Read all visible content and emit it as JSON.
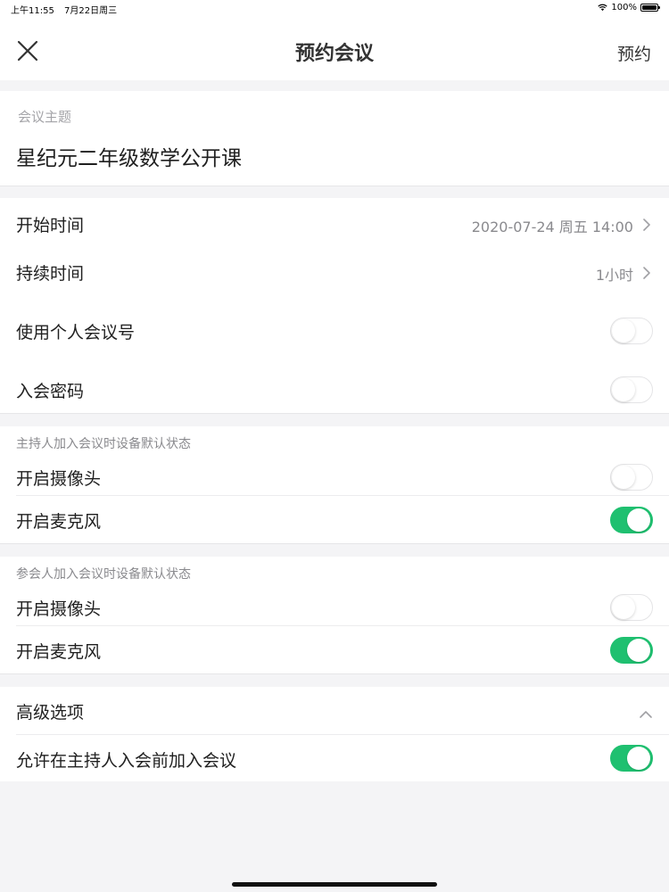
{
  "status_bar": {
    "time": "上午11:55",
    "date": "7月22日周三",
    "battery": "100%"
  },
  "nav": {
    "title": "预约会议",
    "action_label": "预约"
  },
  "topic": {
    "label": "会议主题",
    "value": "星纪元二年级数学公开课"
  },
  "settings": {
    "start_time_label": "开始时间",
    "start_time_value": "2020-07-24 周五 14:00",
    "duration_label": "持续时间",
    "duration_value": "1小时",
    "personal_id_label": "使用个人会议号",
    "personal_id_on": false,
    "password_label": "入会密码",
    "password_on": false
  },
  "host_defaults": {
    "caption": "主持人加入会议时设备默认状态",
    "camera_label": "开启摄像头",
    "camera_on": false,
    "mic_label": "开启麦克风",
    "mic_on": true
  },
  "participant_defaults": {
    "caption": "参会人加入会议时设备默认状态",
    "camera_label": "开启摄像头",
    "camera_on": false,
    "mic_label": "开启麦克风",
    "mic_on": true
  },
  "advanced": {
    "label": "高级选项",
    "expanded": true,
    "join_before_host_label": "允许在主持人入会前加入会议",
    "join_before_host_on": true
  },
  "colors": {
    "toggle_on": "#1fc070",
    "background": "#f4f4f6"
  },
  "icons": {
    "close": "close-icon",
    "chevron_right": "chevron-right-icon",
    "chevron_up": "chevron-up-icon",
    "wifi": "wifi-icon",
    "battery": "battery-icon"
  }
}
